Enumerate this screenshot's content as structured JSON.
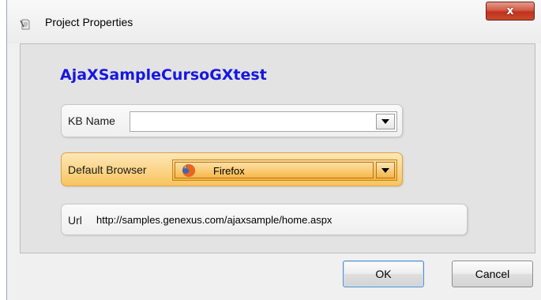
{
  "window": {
    "title": "Project Properties",
    "close_glyph": "x",
    "title_icon": "document-icon"
  },
  "project": {
    "name": "AjaXSampleCursoGXtest"
  },
  "fields": {
    "kb_name": {
      "label": "KB Name",
      "value": ""
    },
    "default_browser": {
      "label": "Default Browser",
      "value": "Firefox",
      "icon": "firefox-icon"
    },
    "url": {
      "label": "Url",
      "value": "http://samples.genexus.com/ajaxsample/home.aspx"
    }
  },
  "buttons": {
    "ok": "OK",
    "cancel": "Cancel"
  },
  "colors": {
    "project_name": "#1717e0",
    "highlight_field": "#f8c45f",
    "close_button": "#c0321e"
  }
}
